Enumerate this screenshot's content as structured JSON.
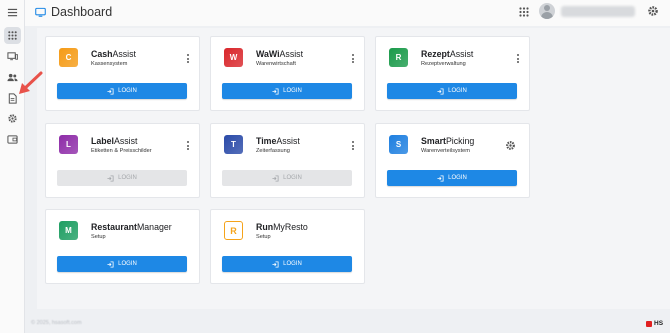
{
  "header": {
    "title": "Dashboard"
  },
  "sidebar": {
    "items": [
      {
        "icon": "menu-icon"
      },
      {
        "icon": "apps-icon",
        "active": true
      },
      {
        "icon": "monitor-icon"
      },
      {
        "icon": "users-icon"
      },
      {
        "icon": "document-icon"
      },
      {
        "icon": "gear-icon"
      },
      {
        "icon": "wallet-icon"
      }
    ]
  },
  "apps": [
    {
      "name_bold": "Cash",
      "name_rest": "Assist",
      "subtitle": "Kassensystem",
      "logo_letter": "C",
      "logo_color": "#f59b16",
      "action": "kebab",
      "login_label": "LOGIN",
      "login_enabled": true
    },
    {
      "name_bold": "WaWi",
      "name_rest": "Assist",
      "subtitle": "Warenwirtschaft",
      "logo_letter": "W",
      "logo_color": "#d9262b",
      "action": "kebab",
      "login_label": "LOGIN",
      "login_enabled": true
    },
    {
      "name_bold": "Rezept",
      "name_rest": "Assist",
      "subtitle": "Rezeptverwaltung",
      "logo_letter": "R",
      "logo_color": "#1a9a4a",
      "action": "kebab",
      "login_label": "LOGIN",
      "login_enabled": true
    },
    {
      "name_bold": "Label",
      "name_rest": "Assist",
      "subtitle": "Etiketten & Preisschilder",
      "logo_letter": "L",
      "logo_color": "#8e2ca8",
      "action": "kebab",
      "login_label": "LOGIN",
      "login_enabled": false
    },
    {
      "name_bold": "Time",
      "name_rest": "Assist",
      "subtitle": "Zeiterfassung",
      "logo_letter": "T",
      "logo_color": "#2a4aa8",
      "action": "kebab",
      "login_label": "LOGIN",
      "login_enabled": false
    },
    {
      "name_bold": "Smart",
      "name_rest": "Picking",
      "subtitle": "Warenverteilsystem",
      "logo_letter": "S",
      "logo_color": "#1e7fe0",
      "action": "gear",
      "login_label": "LOGIN",
      "login_enabled": true
    },
    {
      "name_bold": "Restaurant",
      "name_rest": "Manager",
      "subtitle": "Setup",
      "logo_letter": "M",
      "logo_color": "#1e9e62",
      "action": "none",
      "login_label": "LOGIN",
      "login_enabled": true
    },
    {
      "name_bold": "Run",
      "name_rest": "MyResto",
      "subtitle": "Setup",
      "logo_letter": "R",
      "logo_color": "#f5a31a",
      "logo_style": "outline",
      "action": "none",
      "login_label": "LOGIN",
      "login_enabled": true
    }
  ],
  "footer": {
    "copyright": "© 2025, hsasoft.com",
    "brand": "HS"
  }
}
